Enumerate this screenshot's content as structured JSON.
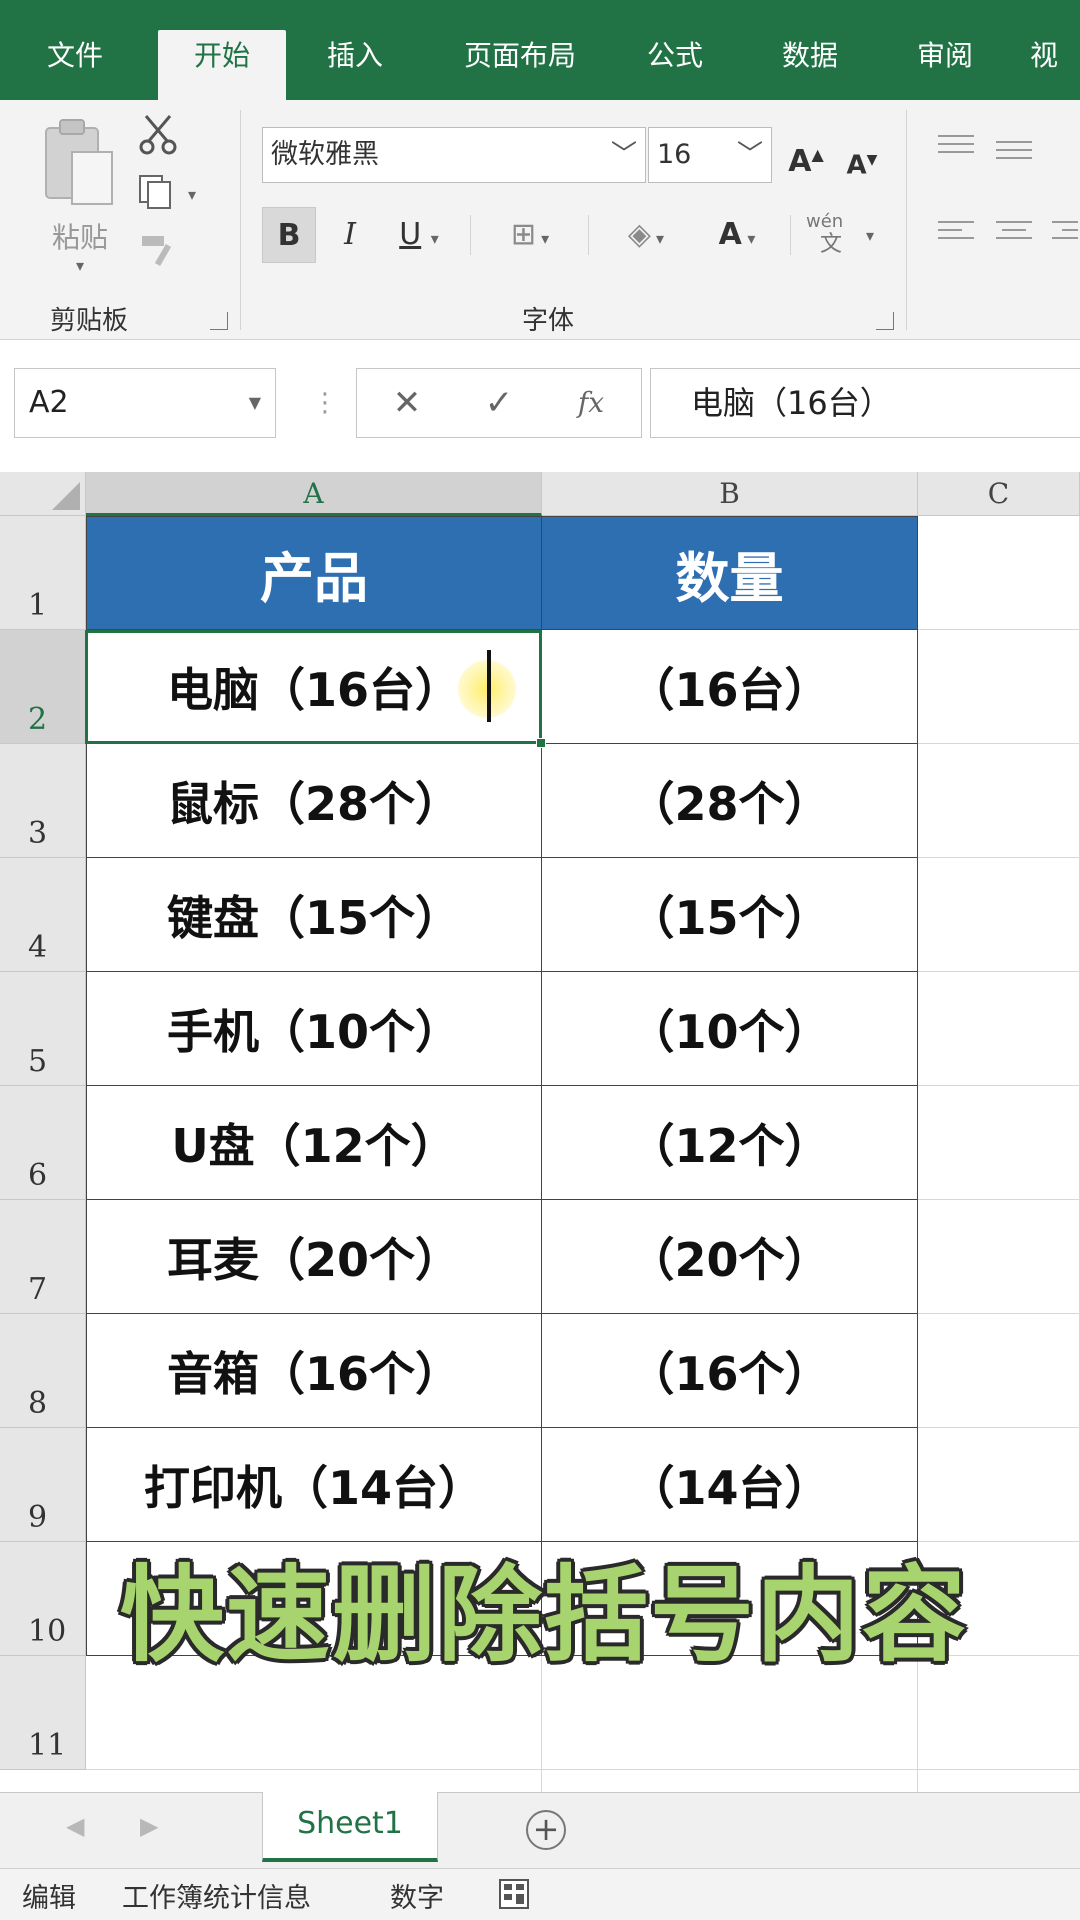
{
  "ribbon_tabs": [
    "文件",
    "开始",
    "插入",
    "页面布局",
    "公式",
    "数据",
    "审阅",
    "视"
  ],
  "clipboard": {
    "paste_label": "粘贴",
    "group_label": "剪贴板"
  },
  "font": {
    "name": "微软雅黑",
    "size": "16",
    "group_label": "字体",
    "bold": "B",
    "italic": "I",
    "underline": "U",
    "grow": "A",
    "shrink": "A",
    "font_color": "A",
    "phonetic": "wén",
    "phonetic_sub": "文"
  },
  "formula_bar": {
    "name_box": "A2",
    "cancel": "✕",
    "enter": "✓",
    "fx": "fx",
    "content": "电脑（16台）"
  },
  "columns": [
    "A",
    "B",
    "C"
  ],
  "rows": [
    "1",
    "2",
    "3",
    "4",
    "5",
    "6",
    "7",
    "8",
    "9",
    "10",
    "11"
  ],
  "table": {
    "header": [
      "产品",
      "数量"
    ],
    "rows": [
      [
        "电脑（16台）",
        "（16台）"
      ],
      [
        "鼠标（28个）",
        "（28个）"
      ],
      [
        "键盘（15个）",
        "（15个）"
      ],
      [
        "手机（10个）",
        "（10个）"
      ],
      [
        "U盘（12个）",
        "（12个）"
      ],
      [
        "耳麦（20个）",
        "（20个）"
      ],
      [
        "音箱（16个）",
        "（16个）"
      ],
      [
        "打印机（14台）",
        "（14台）"
      ]
    ]
  },
  "caption": "快速删除括号内容",
  "sheet_tab": "Sheet1",
  "status": {
    "mode": "编辑",
    "workbook_stats": "工作簿统计信息",
    "number": "数字"
  },
  "colors": {
    "excel_green": "#217346",
    "header_blue": "#2e6fb1",
    "caption_green": "#a8d46f"
  }
}
